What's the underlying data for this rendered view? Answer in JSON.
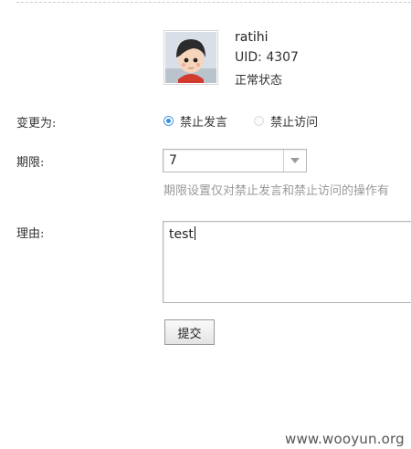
{
  "user": {
    "username": "ratihi",
    "uid": "UID: 4307",
    "status": "正常状态"
  },
  "form": {
    "change_label": "变更为:",
    "options": [
      {
        "label": "禁止发言",
        "checked": true
      },
      {
        "label": "禁止访问",
        "checked": false
      }
    ],
    "period_label": "期限:",
    "period_value": "7",
    "period_hint": "期限设置仅对禁止发言和禁止访问的操作有",
    "reason_label": "理由:",
    "reason_value": "test",
    "submit_label": "提交"
  },
  "watermark": "www.wooyun.org",
  "colors": {
    "radio_accent": "#3b8fe0",
    "hint_text": "#999999",
    "border": "#b8b8b8"
  },
  "icons": {
    "avatar": "cartoon-avatar",
    "select": "chevron-down-icon"
  }
}
